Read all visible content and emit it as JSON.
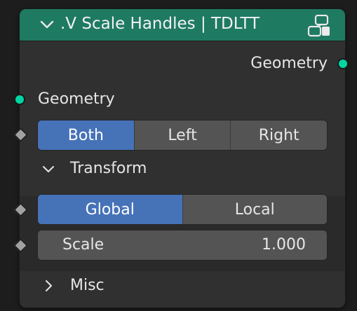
{
  "node": {
    "title": ".V Scale Handles | TDLTT",
    "collapse_icon": "chevron-down-icon",
    "type_icon": "node-group-icon",
    "header_color": "#1f7a62"
  },
  "outputs": [
    {
      "label": "Geometry",
      "socket": "geometry-socket-icon",
      "color": "#00d6a3"
    }
  ],
  "inputs": {
    "geometry": {
      "label": "Geometry"
    },
    "mode": {
      "options": [
        "Both",
        "Left",
        "Right"
      ],
      "selected": "Both"
    }
  },
  "panels": {
    "transform": {
      "label": "Transform",
      "expanded": true,
      "space": {
        "options": [
          "Global",
          "Local"
        ],
        "selected": "Global"
      },
      "scale": {
        "label": "Scale",
        "value": "1.000"
      }
    },
    "misc": {
      "label": "Misc",
      "expanded": false
    }
  },
  "colors": {
    "active": "#4672b8",
    "socket_geometry": "#00d6a3",
    "socket_value": "#a1a1a1"
  }
}
